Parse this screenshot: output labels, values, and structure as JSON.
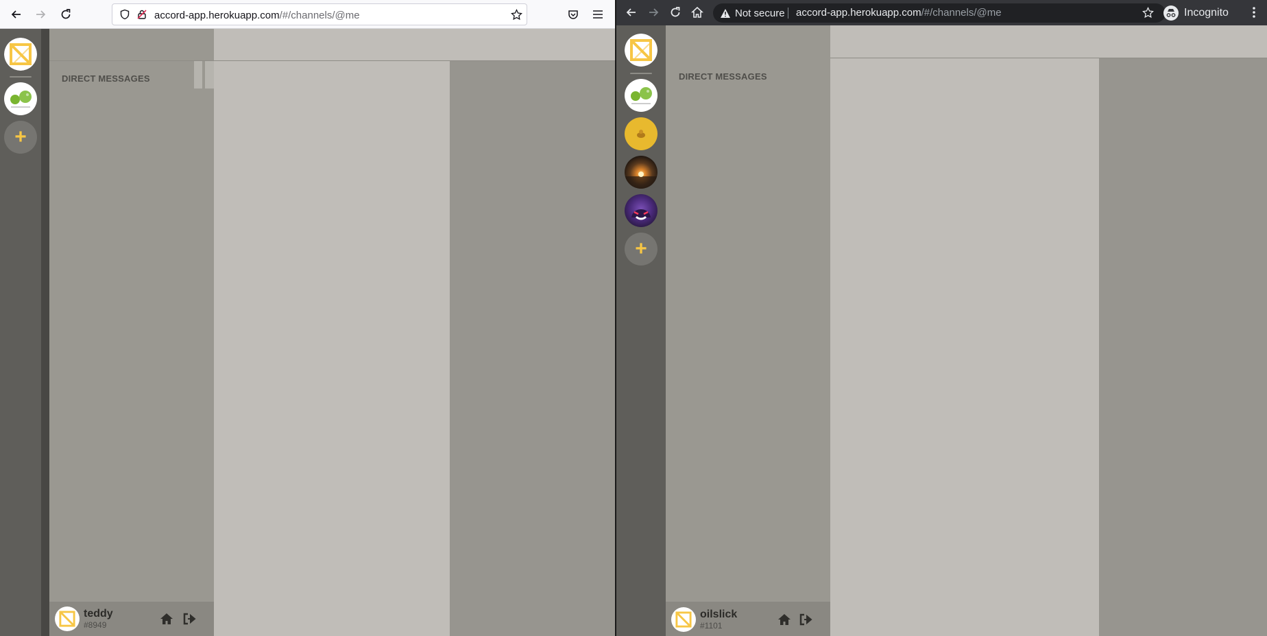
{
  "left_browser": {
    "url_host": "accord-app.herokuapp.com",
    "url_path": "/#/channels/@me"
  },
  "right_browser": {
    "not_secure_label": "Not secure",
    "url_host": "accord-app.herokuapp.com",
    "url_path": "/#/channels/@me",
    "incognito_label": "Incognito"
  },
  "left_app": {
    "dm_heading": "DIRECT MESSAGES",
    "servers": [
      "accord-home-logo",
      "green-blob-server",
      "add-server"
    ],
    "user": {
      "name": "teddy",
      "tag": "#8949"
    }
  },
  "right_app": {
    "dm_heading": "DIRECT MESSAGES",
    "servers": [
      "accord-home-logo",
      "green-blob-server",
      "yellow-server",
      "sunset-server",
      "gengar-server",
      "add-server"
    ],
    "user": {
      "name": "oilslick",
      "tag": "#1101"
    }
  },
  "colors": {
    "accent_yellow": "#f7c645",
    "server_rail": "#5f5e5a",
    "channel_sidebar": "#9a9891",
    "chat_area": "#c0bdb8",
    "member_list": "#97958f"
  }
}
